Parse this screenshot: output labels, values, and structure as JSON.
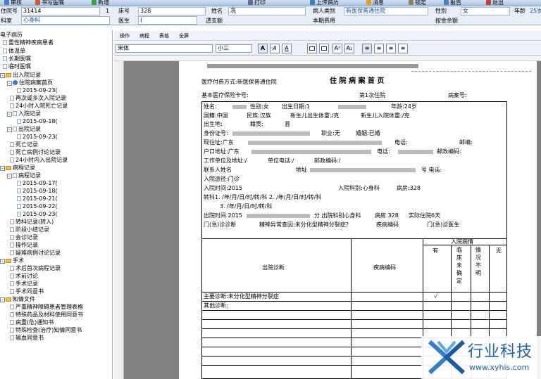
{
  "toolbar": {
    "items": [
      "审核",
      "书写医嘱",
      "新增",
      "打印",
      "上传病历",
      "消息",
      "锁定",
      "报告",
      "退出"
    ]
  },
  "patient": {
    "id_label": "住院号",
    "id_value": "31414",
    "count": "1",
    "bed_label": "床号",
    "bed_value": "328",
    "name_label": "姓名",
    "name_value": "冼",
    "print_label": "打印",
    "type_label": "病人类别",
    "type_value": "新医保普通住院",
    "sex_label": "性别",
    "sex_value": "女",
    "age_label": "年龄",
    "age_value": "25岁",
    "dept_label": "科室",
    "dept_value": "心身科",
    "doctor_label": "医生",
    "doctor_value": "(",
    "balance_label": "透支额",
    "cost_label": "本期费用",
    "deposit_label": "按金余额"
  },
  "tree": {
    "root": "电子病历",
    "items": [
      "重性精神疾病患者",
      "体温单",
      "长期医嘱",
      "临时医嘱",
      "出入院记录",
      "住院病案首页",
      "2015-09-23(",
      "再次或多次入院记录",
      "24小时入院死亡记录",
      "入院记录",
      "2015-09-18(",
      "出院记录",
      "2015-09-23(",
      "死亡记录",
      "死亡病例讨论记录",
      "24小时内入出院记录",
      "病程记录",
      "病程记录",
      "2015-09-17(",
      "2015-09-18(",
      "2015-09-21(",
      "2015-09-22(",
      "2015-09-23(",
      "转科记录(转入)",
      "阶段小结记录",
      "会诊记录",
      "操作记录",
      "疑难病例讨论记录",
      "手术",
      "术后首次病程记录",
      "术前讨论",
      "手术记录",
      "手术同意书",
      "知情文件",
      "严重精神障碍患者管理表格",
      "特殊药品及材料使用同意书",
      "病重(危)通知书",
      "特殊检查(治疗)知情同意书",
      "输血同意书"
    ]
  },
  "editor": {
    "menu": [
      "操作",
      "病程",
      "表格",
      "全屏"
    ],
    "font": "宋体",
    "size": "小三",
    "buttons": [
      "A",
      "A",
      "A",
      "A²",
      "A₂"
    ]
  },
  "doc": {
    "pay": "医疗付费方式:新医保普通住院",
    "title": "住 院 病 案 首 页",
    "insurance": "基本医疗保险卡号:",
    "times": "第1次住院",
    "caseno": "病案号:",
    "r1a": "姓名:",
    "r1b": "性别:女",
    "r1c": "出生日期:1",
    "r1d": "年龄:24岁",
    "r2a": "国籍:中国",
    "r2b": "民族:汉族",
    "r2c": "新生儿出生体重:/克",
    "r2d": "新生儿入院体重:/克",
    "r3": "出生地:",
    "r3b": "籍贯:",
    "r3c": "县",
    "r4a": "身份证号:",
    "r4b": "职业:无",
    "r4c": "婚姻:已婚",
    "r5a": "现住址:广东",
    "r5b": "电话:",
    "r5c": "邮编:",
    "r6a": "户口地址:广东",
    "r6b": "电话:",
    "r6c": "邮政编码:",
    "r7a": "工作单位及地址:/",
    "r7b": "单位电话:/",
    "r7c": "邮政编码:/",
    "r8a": "联系人姓名",
    "r8b": "地址",
    "r8c": "号 电话:",
    "r9": "入院途径:门诊",
    "r10a": "入院时间:2015",
    "r10b": "入院科别:心身科",
    "r10c": "病房:328",
    "r11": "转科1. /年/月/日/时/转/科 2. /年/月/日/时/转/科",
    "r12": "3. /年/月/日/时/转/科",
    "r13a": "出院时间 2015",
    "r13b": "分 出院科别心身科",
    "r13c": "病房 328",
    "r13d": "实际住院6天",
    "r14a": "门(急)诊诊断",
    "r14b": "精神异常查因:未分化型精神分裂症?",
    "r14c": "疾病编码",
    "r14d": "门(急)诊医生",
    "th_diag": "出院诊断",
    "th_code": "疾病编码",
    "th_cond": "入院病情",
    "th_c1": "有",
    "th_c2": "临床未确定",
    "th_c3": "情况不明",
    "th_c4": "无",
    "main": "主要诊断:未分化型精神分裂症",
    "check": "√",
    "other": "其他诊断:"
  },
  "logo": {
    "name": "行业科技",
    "url": "www.xyhis.com"
  }
}
